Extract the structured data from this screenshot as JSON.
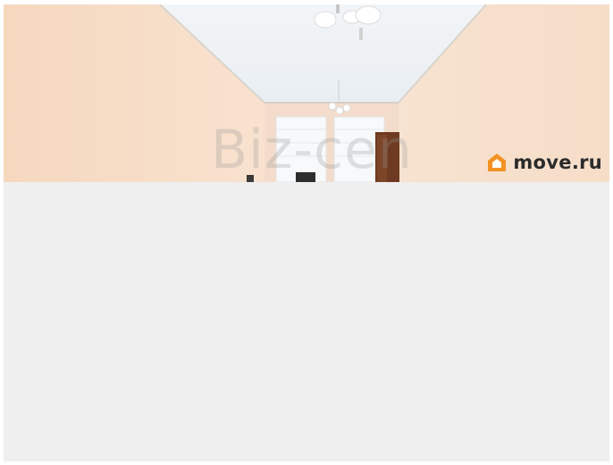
{
  "photo": {
    "watermark_text": "Biz-cen",
    "brand_text": "move.ru",
    "brand_icon": "house-icon",
    "colors": {
      "wall": "#f4d6bd",
      "ceiling": "#f3f6f8",
      "panel_bg": "#efefef",
      "brand_orange": "#f39223"
    }
  }
}
